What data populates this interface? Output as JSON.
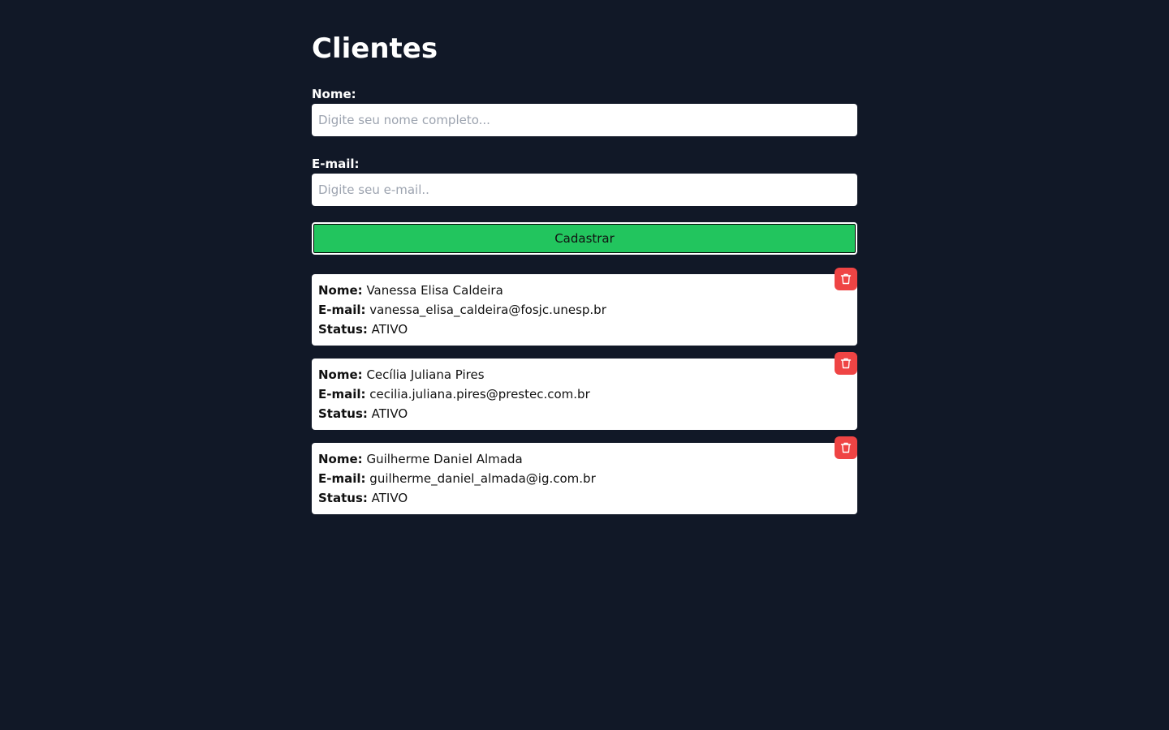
{
  "page": {
    "title": "Clientes"
  },
  "form": {
    "name_label": "Nome:",
    "name_placeholder": "Digite seu nome completo...",
    "name_value": "",
    "email_label": "E-mail:",
    "email_placeholder": "Digite seu e-mail..",
    "email_value": "",
    "submit_label": "Cadastrar"
  },
  "labels": {
    "name": "Nome:",
    "email": "E-mail:",
    "status": "Status:"
  },
  "clients": [
    {
      "name": "Vanessa Elisa Caldeira",
      "email": "vanessa_elisa_caldeira@fosjc.unesp.br",
      "status": "ATIVO"
    },
    {
      "name": "Cecília Juliana Pires",
      "email": "cecilia.juliana.pires@prestec.com.br",
      "status": "ATIVO"
    },
    {
      "name": "Guilherme Daniel Almada",
      "email": "guilherme_daniel_almada@ig.com.br",
      "status": "ATIVO"
    }
  ],
  "icons": {
    "delete": "trash-icon"
  },
  "colors": {
    "background": "#111827",
    "submit": "#22c55e",
    "delete": "#ef4444",
    "card": "#ffffff"
  }
}
